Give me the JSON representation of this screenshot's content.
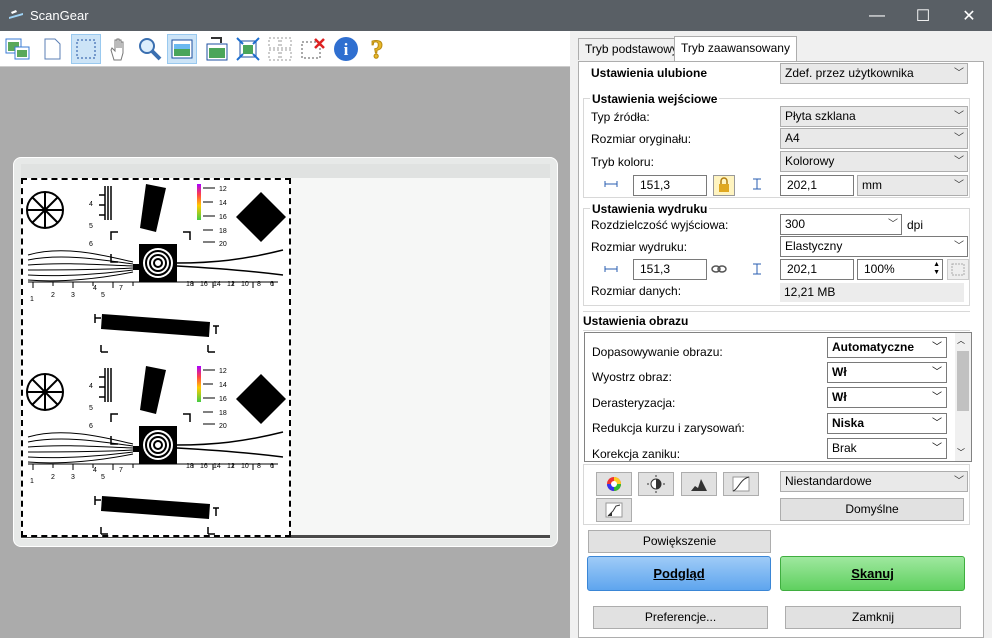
{
  "window": {
    "title": "ScanGear",
    "minimize": "—",
    "maximize": "☐",
    "close": "✕"
  },
  "toolbar": {
    "items": [
      "thumbnail-icon",
      "whole-image-icon",
      "crop-icon",
      "hand-icon",
      "zoom-icon",
      "auto-crop-icon",
      "rotate-left-icon",
      "rotate-right-icon",
      "multi-crop-icon",
      "remove-crop-icon",
      "info-icon",
      "help-icon"
    ]
  },
  "tabs": {
    "basic": "Tryb podstawowy",
    "advanced": "Tryb zaawansowany"
  },
  "favorites": {
    "label": "Ustawienia ulubione",
    "value": "Zdef. przez użytkownika"
  },
  "input": {
    "title": "Ustawienia wejściowe",
    "source_label": "Typ źródła:",
    "source_value": "Płyta szklana",
    "size_label": "Rozmiar oryginału:",
    "size_value": "A4",
    "color_label": "Tryb koloru:",
    "color_value": "Kolorowy",
    "width": "151,3",
    "height": "202,1",
    "unit": "mm"
  },
  "output": {
    "title": "Ustawienia wydruku",
    "res_label": "Rozdzielczość wyjściowa:",
    "res_value": "300",
    "res_unit": "dpi",
    "size_label": "Rozmiar wydruku:",
    "size_value": "Elastyczny",
    "width": "151,3",
    "height": "202,1",
    "scale": "100%",
    "data_label": "Rozmiar danych:",
    "data_value": "12,21 MB"
  },
  "image": {
    "title": "Ustawienia obrazu",
    "rows": [
      {
        "label": "Dopasowywanie obrazu:",
        "value": "Automatyczne"
      },
      {
        "label": "Wyostrz obraz:",
        "value": "Wł"
      },
      {
        "label": "Derasteryzacja:",
        "value": "Wł"
      },
      {
        "label": "Redukcja kurzu i zarysowań:",
        "value": "Niska"
      },
      {
        "label": "Korekcja zaniku:",
        "value": "Brak"
      }
    ]
  },
  "adjust": {
    "preset": "Niestandardowe",
    "defaults": "Domyślne"
  },
  "buttons": {
    "zoom": "Powiększenie",
    "preview": "Podgląd",
    "scan": "Skanuj",
    "prefs": "Preferencje...",
    "close": "Zamknij"
  },
  "colors": {
    "titlebar": "#595f65",
    "preview_button": "#6fb0f2",
    "scan_button": "#74d874"
  },
  "chart_ticks": {
    "left": [
      "4",
      "5",
      "6"
    ],
    "right": [
      "12",
      "14",
      "16",
      "18",
      "20"
    ],
    "bottom": [
      "1",
      "2",
      "3",
      "4",
      "5",
      "6",
      "7",
      "8",
      "9",
      "10",
      "12",
      "14",
      "16",
      "18"
    ],
    "bottom_right": [
      "18",
      "16",
      "14",
      "12",
      "10",
      "8",
      "6"
    ]
  }
}
